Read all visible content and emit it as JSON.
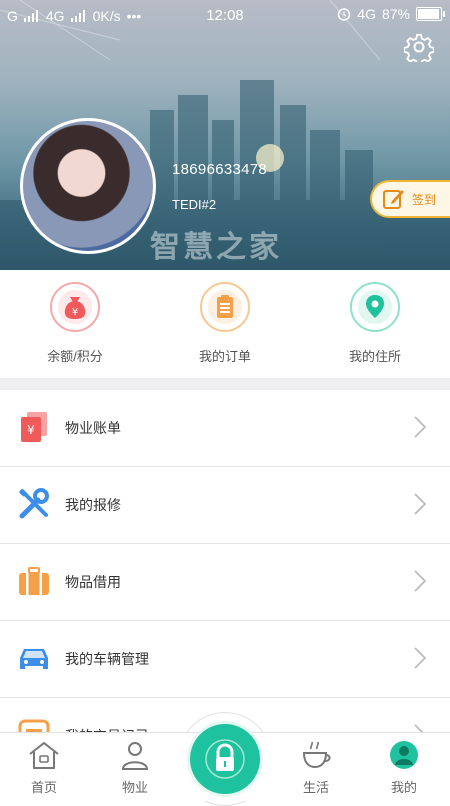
{
  "status_bar": {
    "carrier_left": "G",
    "network": "4G",
    "speed": "0K/s",
    "dots": "•••",
    "time": "12:08",
    "network_right": "4G",
    "battery": "87%",
    "battery_level": 0.87
  },
  "profile": {
    "phone": "18696633478",
    "username": "TEDI#2",
    "watermark": "智慧之家"
  },
  "signin": {
    "label": "签到"
  },
  "quick_actions": [
    {
      "label": "余额/积分",
      "icon": "money-bag-icon",
      "color": "#f05a5a"
    },
    {
      "label": "我的订单",
      "icon": "clipboard-icon",
      "color": "#f5a048"
    },
    {
      "label": "我的住所",
      "icon": "location-pin-icon",
      "color": "#1fc29e"
    }
  ],
  "menu": [
    {
      "label": "物业账单",
      "icon": "bill-icon",
      "color": "#f05a5a"
    },
    {
      "label": "我的报修",
      "icon": "tools-icon",
      "color": "#3d8ee8"
    },
    {
      "label": "物品借用",
      "icon": "suitcase-icon",
      "color": "#f5a048"
    },
    {
      "label": "我的车辆管理",
      "icon": "car-icon",
      "color": "#3d8ee8"
    },
    {
      "label": "我的交易记录",
      "icon": "record-icon",
      "color": "#f5a048"
    }
  ],
  "nav": [
    {
      "label": "首页",
      "icon": "home-icon"
    },
    {
      "label": "物业",
      "icon": "person-icon"
    },
    {
      "label": "生活",
      "icon": "coffee-cup-icon"
    },
    {
      "label": "我的",
      "icon": "profile-icon"
    }
  ],
  "colors": {
    "accent": "#1fc29e",
    "signin": "#e38b18"
  }
}
